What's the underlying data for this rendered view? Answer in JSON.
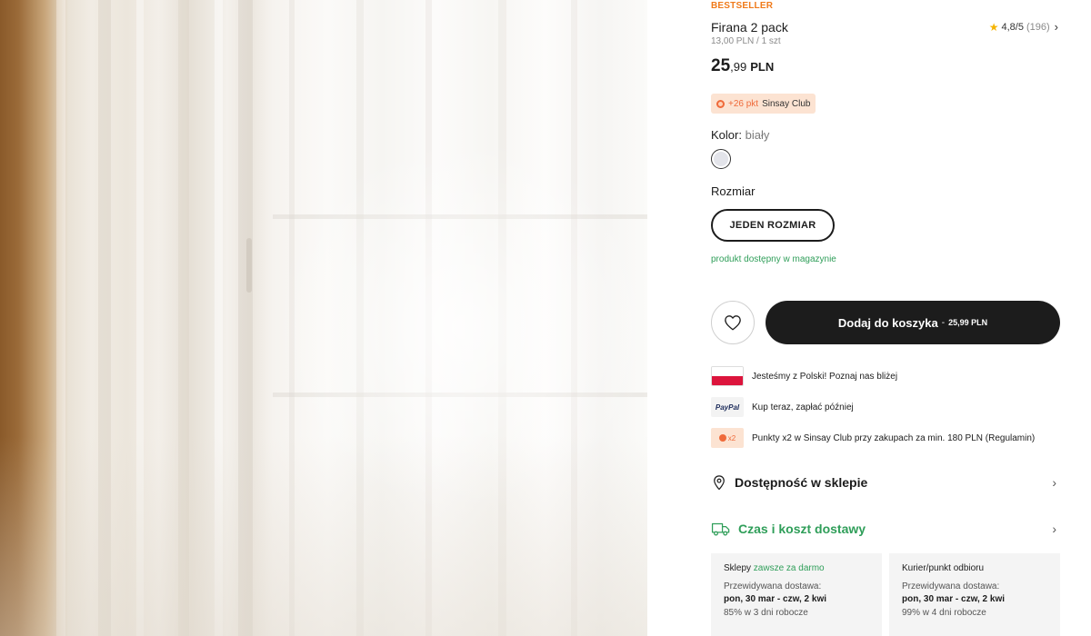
{
  "product": {
    "badge": "BESTSELLER",
    "title": "Firana 2 pack",
    "unit_price": "13,00 PLN / 1 szt",
    "rating": {
      "score": "4,8/5",
      "count": "(196)"
    },
    "price": {
      "integer": "25",
      "decimals": ",99",
      "currency": "PLN"
    },
    "club_points": {
      "points": "+26 pkt",
      "program": "Sinsay Club"
    },
    "color": {
      "label": "Kolor:",
      "value": "biały",
      "swatch": "#e3e4ea"
    },
    "size": {
      "label": "Rozmiar",
      "option": "JEDEN ROZMIAR"
    },
    "availability": "produkt dostępny w magazynie"
  },
  "actions": {
    "wishlist_icon": "heart-icon",
    "cart_label": "Dodaj do koszyka",
    "cart_separator": "-",
    "cart_amount": "25,99 PLN"
  },
  "perks": [
    {
      "icon": "poland-flag-icon",
      "text": "Jesteśmy z Polski! Poznaj nas bliżej"
    },
    {
      "icon": "paypal-icon",
      "icon_text": "PayPal",
      "text": "Kup teraz, zapłać później"
    },
    {
      "icon": "club-x2-icon",
      "icon_text": "x2",
      "text": "Punkty x2 w Sinsay Club przy zakupach za min. 180 PLN (Regulamin)"
    }
  ],
  "accordions": {
    "store_availability": "Dostępność w sklepie",
    "delivery": "Czas i koszt dostawy"
  },
  "delivery_cards": [
    {
      "title": "Sklepy",
      "highlight": "zawsze za darmo",
      "expected_label": "Przewidywana dostawa:",
      "dates": "pon, 30 mar - czw, 2 kwi",
      "percent": "85% w 3 dni robocze"
    },
    {
      "title": "Kurier/punkt odbioru",
      "highlight": "",
      "expected_label": "Przewidywana dostawa:",
      "dates": "pon, 30 mar - czw, 2 kwi",
      "percent": "99% w 4 dni robocze"
    }
  ],
  "colors": {
    "accent_orange": "#f07a1a",
    "availability_green": "#2f9e59",
    "cart_button": "#1c1c1c",
    "club_badge_bg": "#fce3d2"
  }
}
